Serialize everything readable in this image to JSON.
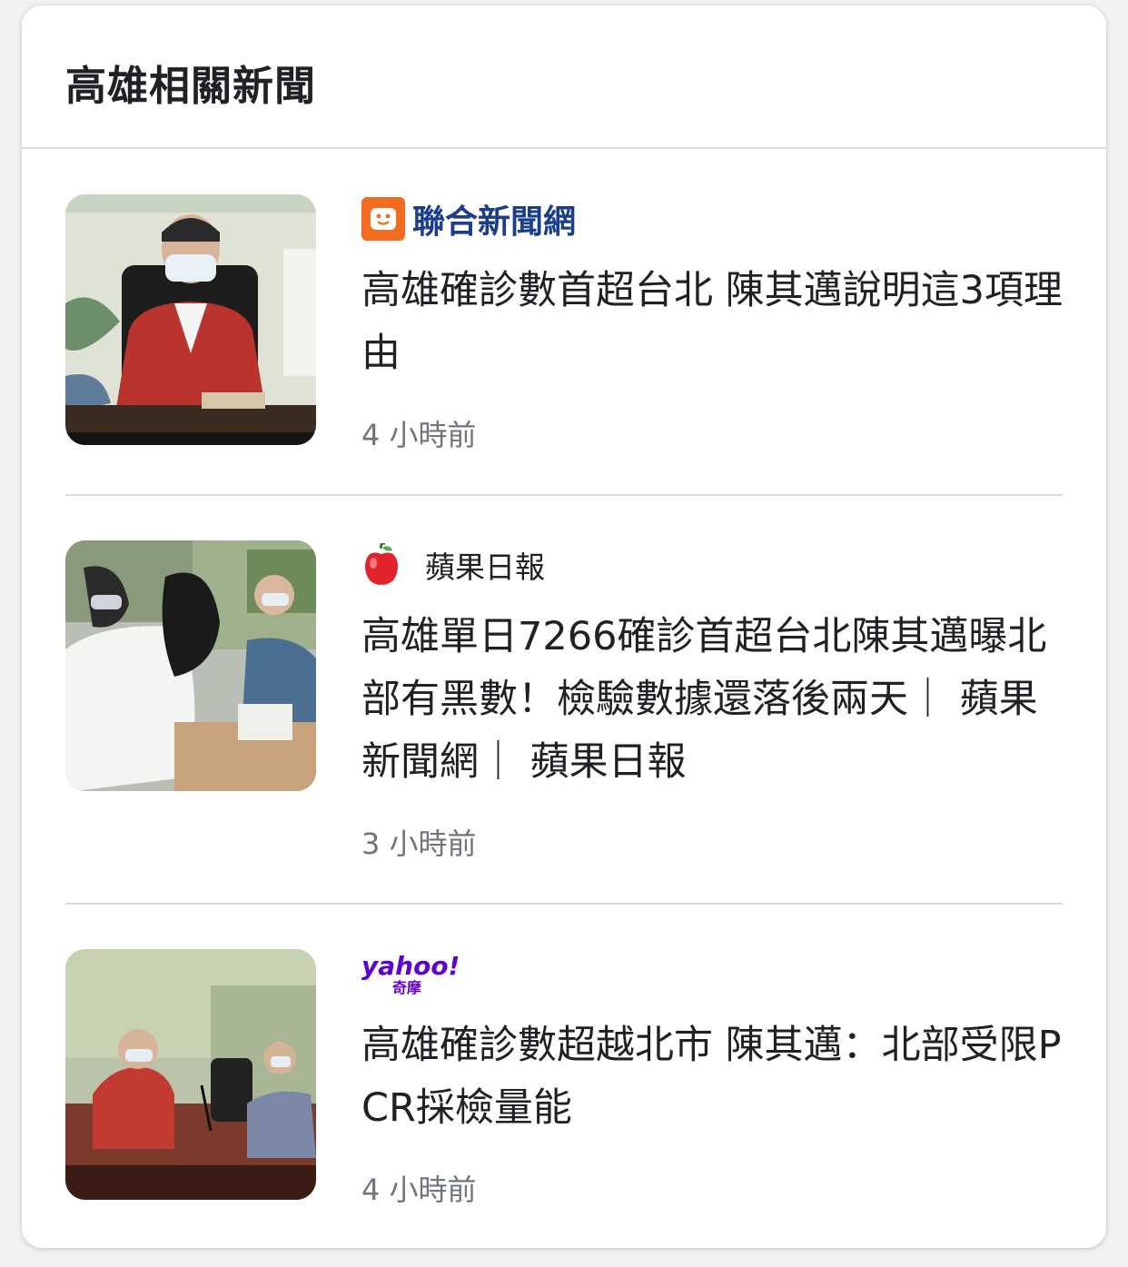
{
  "header": {
    "title": "高雄相關新聞"
  },
  "items": [
    {
      "source": "聯合新聞網",
      "headline": "高雄確診數首超台北 陳其邁說明這3項理由",
      "time": "4 小時前"
    },
    {
      "source": "蘋果日報",
      "headline": "高雄單日7266確診首超台北陳其邁曝北部有黑數！檢驗數據還落後兩天｜ 蘋果新聞網｜ 蘋果日報",
      "time": "3 小時前"
    },
    {
      "source_logo_text": "yahoo!",
      "source_logo_sub": "奇摩",
      "headline": "高雄確診數超越北市 陳其邁：北部受限PCR採檢量能",
      "time": "4 小時前"
    }
  ],
  "colors": {
    "udn_orange": "#f26b21",
    "udn_blue": "#1b3e8c",
    "yahoo_purple": "#6001d2",
    "apple_red": "#e0242c"
  }
}
